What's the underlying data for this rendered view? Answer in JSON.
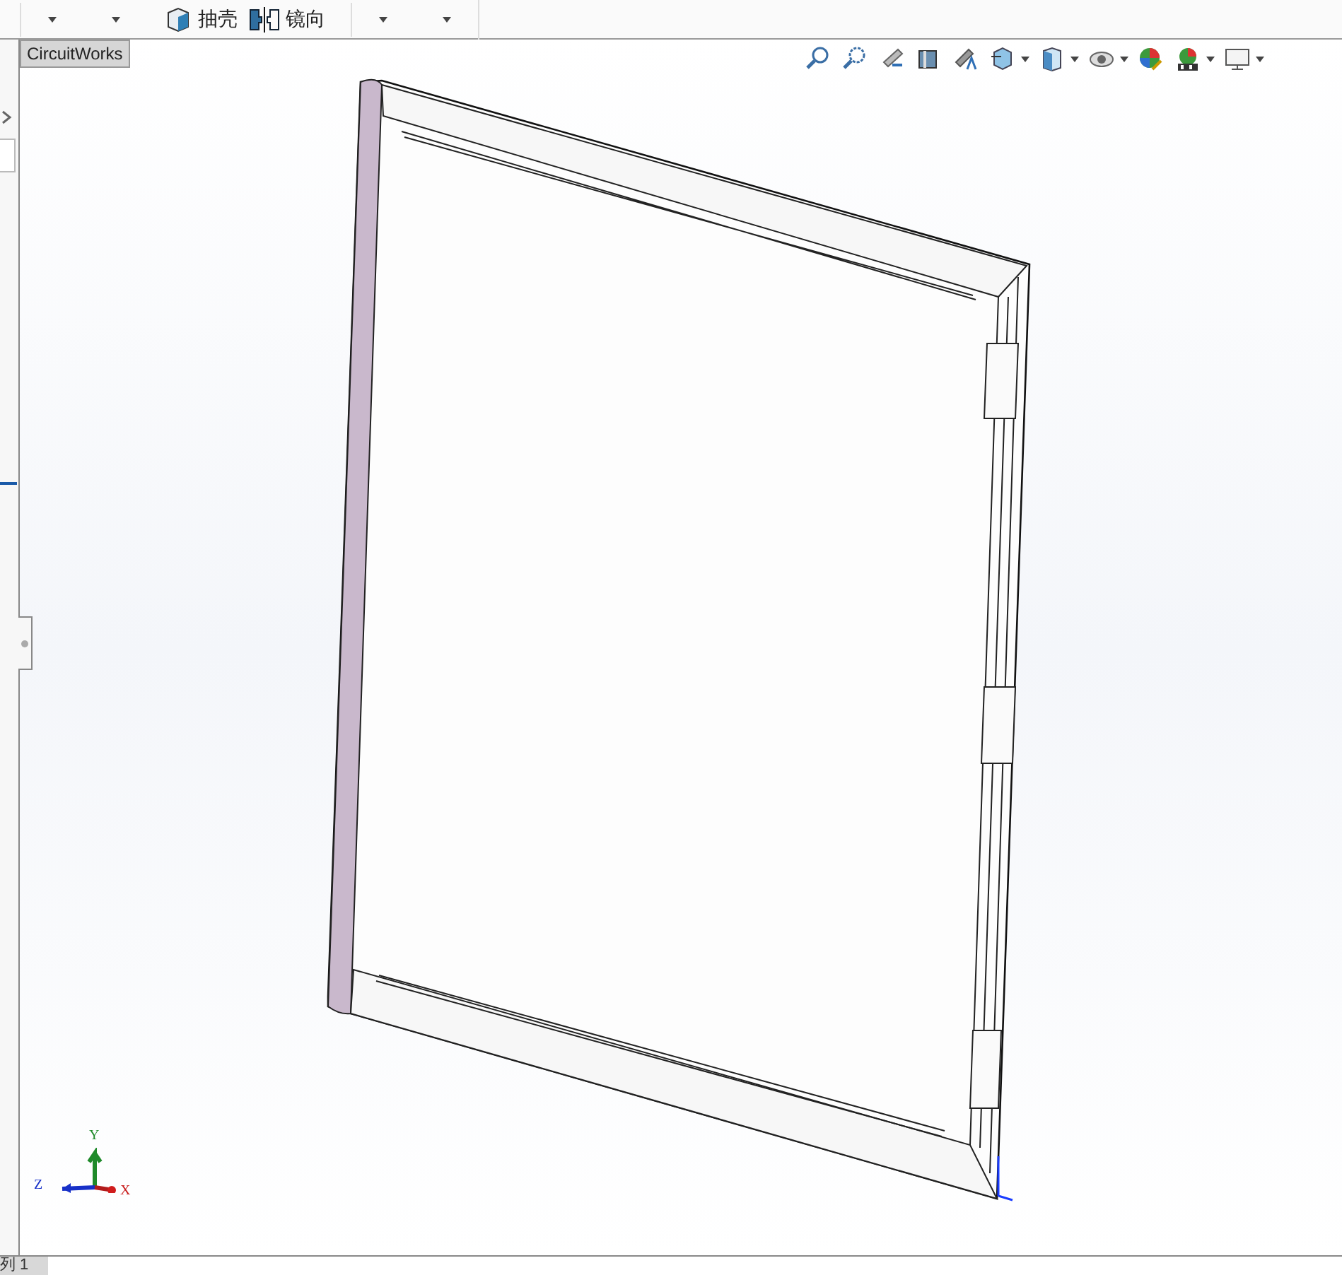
{
  "toolbar": {
    "items": [
      {
        "kind": "dropdown"
      },
      {
        "kind": "dropdown"
      },
      {
        "kind": "shell",
        "label": "抽壳"
      },
      {
        "kind": "mirror",
        "label": "镜向"
      },
      {
        "kind": "dropdown"
      },
      {
        "kind": "dropdown"
      }
    ]
  },
  "tabs": [
    {
      "label": "CircuitWorks",
      "selected": true
    }
  ],
  "view_tools": [
    {
      "menu": false
    },
    {
      "menu": false
    },
    {
      "menu": false
    },
    {
      "menu": false
    },
    {
      "menu": false
    },
    {
      "menu": true
    },
    {
      "menu": true
    },
    {
      "menu": true
    },
    {
      "menu": false
    },
    {
      "menu": true
    },
    {
      "menu": true
    }
  ],
  "triad": {
    "y": "Y",
    "z": "Z",
    "x": "X"
  },
  "status_bar": {
    "tab": "列 1"
  }
}
